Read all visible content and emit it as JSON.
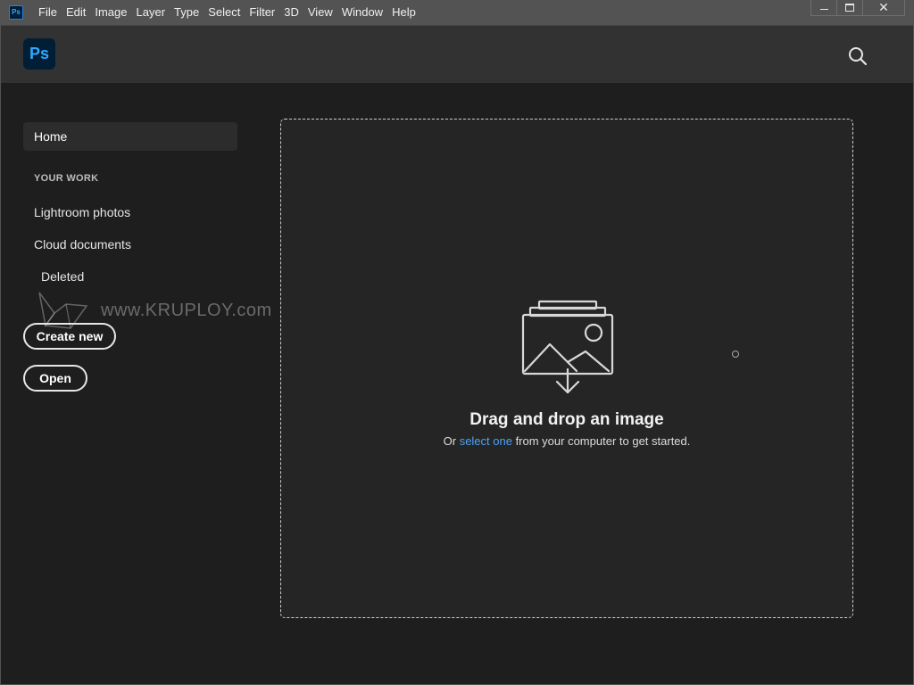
{
  "menubar": {
    "app_icon_label": "Ps",
    "items": [
      "File",
      "Edit",
      "Image",
      "Layer",
      "Type",
      "Select",
      "Filter",
      "3D",
      "View",
      "Window",
      "Help"
    ],
    "controls": {
      "minimize": "minimize-icon",
      "maximize": "maximize-icon",
      "close": "✕"
    }
  },
  "header": {
    "logo_label": "Ps",
    "search_icon": "search-icon"
  },
  "sidebar": {
    "home_label": "Home",
    "section_label": "YOUR WORK",
    "links": [
      "Lightroom photos",
      "Cloud documents",
      "Deleted"
    ],
    "create_new_label": "Create new",
    "open_label": "Open",
    "watermark_text": "www.KRUPLOY.com"
  },
  "dropzone": {
    "title": "Drag and drop an image",
    "sub_before": "Or ",
    "sub_link": "select one",
    "sub_after": " from your computer to get started."
  },
  "colors": {
    "accent": "#31a8ff",
    "link": "#4ba3f7",
    "logo_bg": "#001e36",
    "menubar_bg": "#535353",
    "header_bg": "#323232",
    "body_bg": "#1e1e1e"
  }
}
